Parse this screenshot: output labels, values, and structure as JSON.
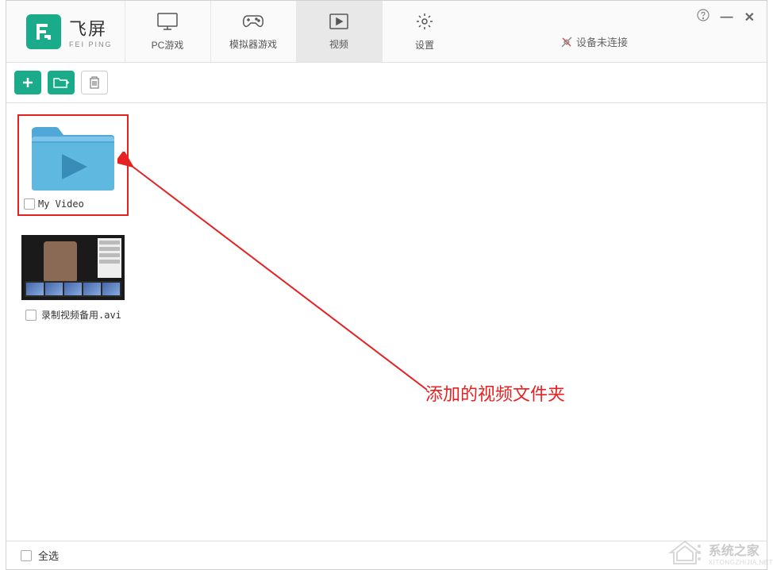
{
  "app": {
    "name_cn": "飞屏",
    "name_en": "FEI PING"
  },
  "tabs": [
    {
      "label": "PC游戏",
      "icon": "monitor"
    },
    {
      "label": "模拟器游戏",
      "icon": "gamepad"
    },
    {
      "label": "视频",
      "icon": "play-box",
      "active": true
    },
    {
      "label": "设置",
      "icon": "gear"
    }
  ],
  "device_status": "设备未连接",
  "toolbar": {
    "add_btn": "add",
    "folder_btn": "add-folder",
    "delete_btn": "delete"
  },
  "items": [
    {
      "type": "folder",
      "label": "My Video",
      "highlighted": true
    },
    {
      "type": "video",
      "label": "录制视频备用.avi"
    }
  ],
  "footer": {
    "select_all": "全选"
  },
  "annotation": {
    "text": "添加的视频文件夹"
  },
  "watermark": {
    "name_cn": "系统之家",
    "name_en": "XITONGZHIJIA.NET"
  }
}
